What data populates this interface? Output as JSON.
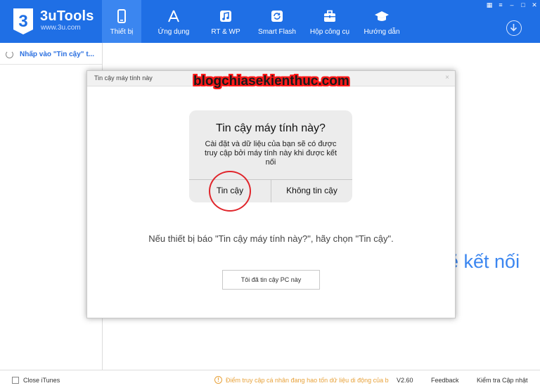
{
  "app": {
    "name": "3uTools",
    "url": "www.3u.com",
    "accent_color": "#1f6fe5"
  },
  "nav": [
    {
      "label": "Thiết bị",
      "icon": "phone-icon",
      "active": true
    },
    {
      "label": "Ứng dụng",
      "icon": "appstore-icon",
      "active": false
    },
    {
      "label": "RT & WP",
      "icon": "music-icon",
      "active": false
    },
    {
      "label": "Smart Flash",
      "icon": "refresh-icon",
      "active": false
    },
    {
      "label": "Hộp công cụ",
      "icon": "toolbox-icon",
      "active": false
    },
    {
      "label": "Hướng dẫn",
      "icon": "graduation-cap-icon",
      "active": false
    }
  ],
  "sidebar": {
    "item_label": "Nhấp vào \"Tin cậy\" t..."
  },
  "background_text": "ẽ kết nối",
  "dialog": {
    "title": "Tin cậy máy tính này",
    "close_glyph": "×",
    "watermark": "blogchiasekienthuc.com",
    "ios_alert": {
      "title": "Tin cậy máy tính này?",
      "message": "Cài đặt và dữ liệu của bạn sẽ có được truy cập bởi máy tính này khi được kết nối",
      "trust_label": "Tin cậy",
      "dont_trust_label": "Không tin cậy"
    },
    "instruction": "Nếu thiết bị báo \"Tin cậy máy tính này?\", hãy chọn \"Tin cậy\".",
    "confirm_label": "Tôi đã tin cậy PC này"
  },
  "statusbar": {
    "close_itunes": "Close iTunes",
    "warning": "Điểm truy cập cá nhân đang hao tốn dữ liệu di động của b",
    "version": "V2.60",
    "feedback": "Feedback",
    "check_update": "Kiểm tra Cập nhật"
  }
}
